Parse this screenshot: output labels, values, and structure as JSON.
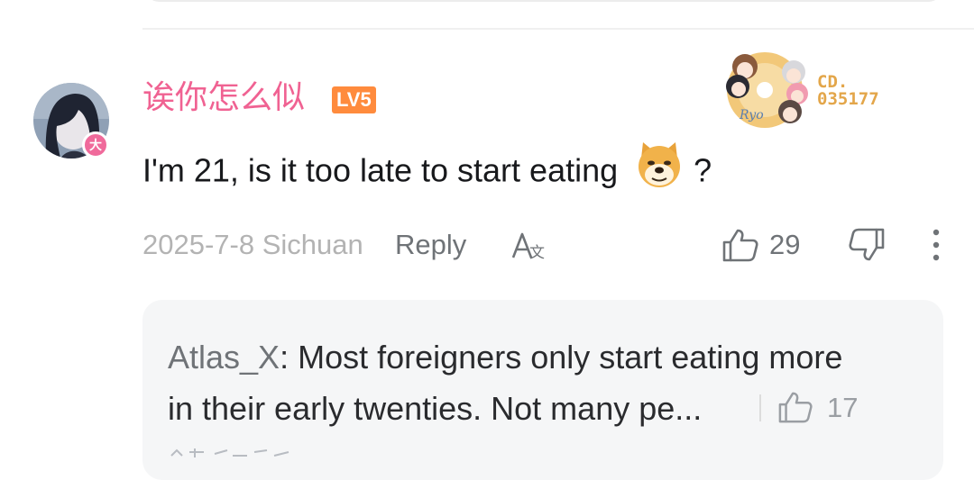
{
  "comment": {
    "username": "诶你怎么似",
    "level_badge": "LV5",
    "avatar_badge": "大",
    "text_before_emoji": "I'm 21, is it too late to start eating",
    "emoji": "doge",
    "text_after_emoji": "?",
    "decoration_label": "CD.",
    "decoration_number": "035177",
    "date_location": "2025-7-8 Sichuan",
    "reply_label": "Reply",
    "likes": "29"
  },
  "reply": {
    "username": "Atlas_X",
    "line1": "Most foreigners only start eating more",
    "line2": "in their early twenties. Not many pe...",
    "likes": "17"
  },
  "colors": {
    "username": "#f06292",
    "level": "#ff8b3d",
    "meta_gray": "#b3b3b3",
    "icon_gray": "#6f7377",
    "reply_bg": "#f5f6f7"
  }
}
